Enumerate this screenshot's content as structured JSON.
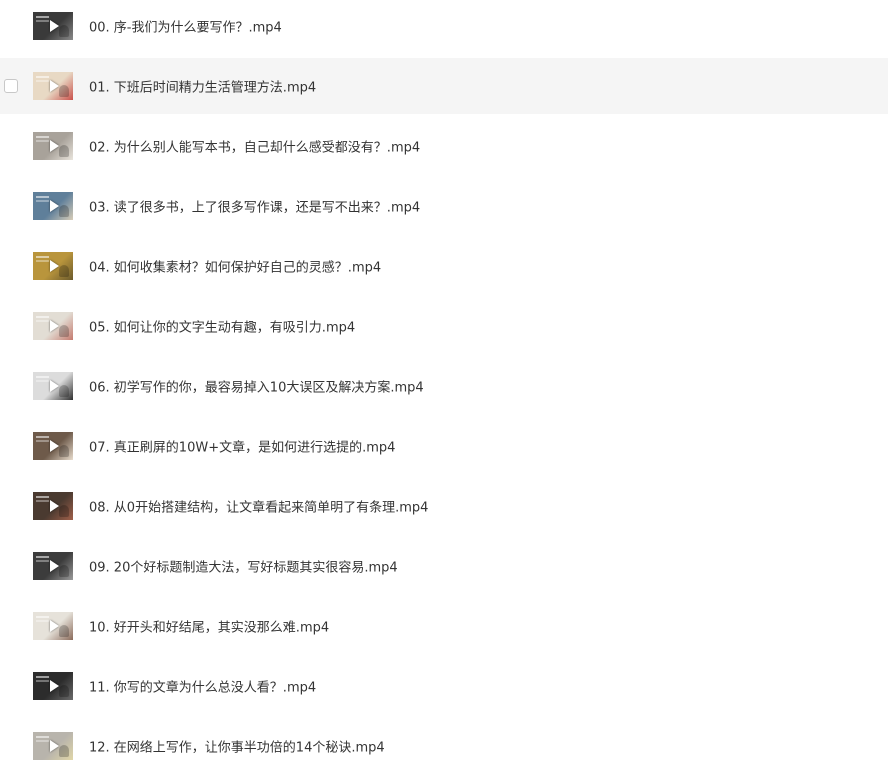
{
  "files": [
    {
      "name": "00. 序-我们为什么要写作？.mp4",
      "thumb_color": "#3a3a3a",
      "thumb_color2": "#8a8a8a",
      "hovered": false
    },
    {
      "name": "01. 下班后时间精力生活管理方法.mp4",
      "thumb_color": "#e8d9c4",
      "thumb_color2": "#c9504a",
      "hovered": true
    },
    {
      "name": "02. 为什么别人能写本书，自己却什么感受都没有？.mp4",
      "thumb_color": "#a8a29a",
      "thumb_color2": "#e9e4dc",
      "hovered": false
    },
    {
      "name": "03. 读了很多书，上了很多写作课，还是写不出来？.mp4",
      "thumb_color": "#5f7f9a",
      "thumb_color2": "#d8cdb8",
      "hovered": false
    },
    {
      "name": "04. 如何收集素材？如何保护好自己的灵感？.mp4",
      "thumb_color": "#b9953c",
      "thumb_color2": "#6b5a2c",
      "hovered": false
    },
    {
      "name": "05. 如何让你的文字生动有趣，有吸引力.mp4",
      "thumb_color": "#e2ddd4",
      "thumb_color2": "#c47a6e",
      "hovered": false
    },
    {
      "name": "06. 初学写作的你，最容易掉入10大误区及解决方案.mp4",
      "thumb_color": "#dcdcdc",
      "thumb_color2": "#2e2e2e",
      "hovered": false
    },
    {
      "name": "07. 真正刷屏的10W+文章，是如何进行选提的.mp4",
      "thumb_color": "#6e5a4a",
      "thumb_color2": "#e8dccd",
      "hovered": false
    },
    {
      "name": "08. 从0开始搭建结构，让文章看起来简单明了有条理.mp4",
      "thumb_color": "#4a3a30",
      "thumb_color2": "#a0604a",
      "hovered": false
    },
    {
      "name": "09. 20个好标题制造大法，写好标题其实很容易.mp4",
      "thumb_color": "#3c3c3c",
      "thumb_color2": "#9a9a9a",
      "hovered": false
    },
    {
      "name": "10. 好开头和好结尾，其实没那么难.mp4",
      "thumb_color": "#e6e2da",
      "thumb_color2": "#8a6a5a",
      "hovered": false
    },
    {
      "name": "11. 你写的文章为什么总没人看？.mp4",
      "thumb_color": "#2c2c2c",
      "thumb_color2": "#6a6a6a",
      "hovered": false
    },
    {
      "name": "12. 在网络上写作，让你事半功倍的14个秘诀.mp4",
      "thumb_color": "#b8b4ac",
      "thumb_color2": "#e0d6a8",
      "hovered": false
    }
  ],
  "icons": {
    "play": "play-icon"
  },
  "colors": {
    "hover_bg": "#f5f5f5",
    "text": "#333333"
  }
}
